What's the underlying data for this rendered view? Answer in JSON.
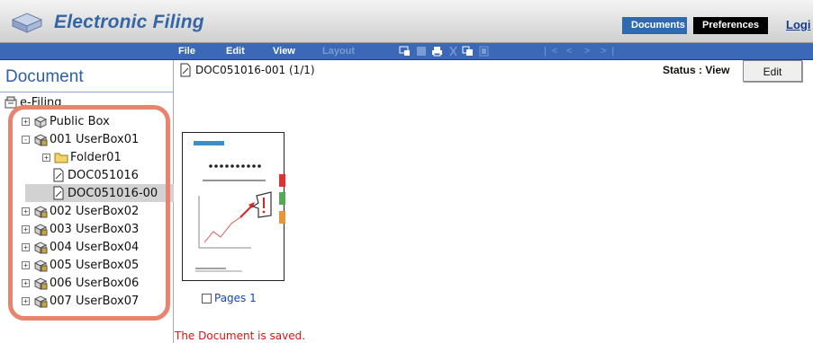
{
  "header": {
    "app_title": "Electronic Filing",
    "tabs": [
      "Documents",
      "Preferences"
    ],
    "logout_label": "Logi"
  },
  "toolbar": {
    "menus": [
      {
        "label": "File",
        "enabled": true
      },
      {
        "label": "Edit",
        "enabled": true
      },
      {
        "label": "View",
        "enabled": true
      },
      {
        "label": "Layout",
        "enabled": false
      }
    ],
    "icons": [
      "properties-icon",
      "save-icon",
      "print-icon",
      "cut-icon",
      "copy-icon",
      "paste-icon"
    ],
    "nav": [
      "|<",
      "<",
      ">",
      ">|"
    ]
  },
  "left_pane": {
    "title": "Document",
    "root": "e-Filing",
    "tree": [
      {
        "label": "Public Box",
        "type": "public-box",
        "expander": "+"
      },
      {
        "label": "001 UserBox01",
        "type": "user-box",
        "expander": "-"
      },
      {
        "label": "Folder01",
        "type": "folder",
        "expander": "+"
      },
      {
        "label": "DOC051016",
        "type": "document",
        "expander": ""
      },
      {
        "label": "DOC051016-00",
        "type": "document",
        "expander": "",
        "selected": true
      },
      {
        "label": "002 UserBox02",
        "type": "user-box",
        "expander": "+"
      },
      {
        "label": "003 UserBox03",
        "type": "user-box",
        "expander": "+"
      },
      {
        "label": "004 UserBox04",
        "type": "user-box",
        "expander": "+"
      },
      {
        "label": "005 UserBox05",
        "type": "user-box",
        "expander": "+"
      },
      {
        "label": "006 UserBox06",
        "type": "user-box",
        "expander": "+"
      },
      {
        "label": "007 UserBox07",
        "type": "user-box",
        "expander": "+"
      }
    ]
  },
  "main": {
    "doc_title": "DOC051016-001",
    "page_count": "(1/1)",
    "status": "Status : View",
    "edit_label": "Edit",
    "thumbnail_caption": "Pages 1",
    "message": "The Document is saved."
  },
  "colors": {
    "header_blue": "#3465a4",
    "toolbar": "#3b68b7",
    "highlight": "#e8836e",
    "message_red": "#dd1111"
  }
}
